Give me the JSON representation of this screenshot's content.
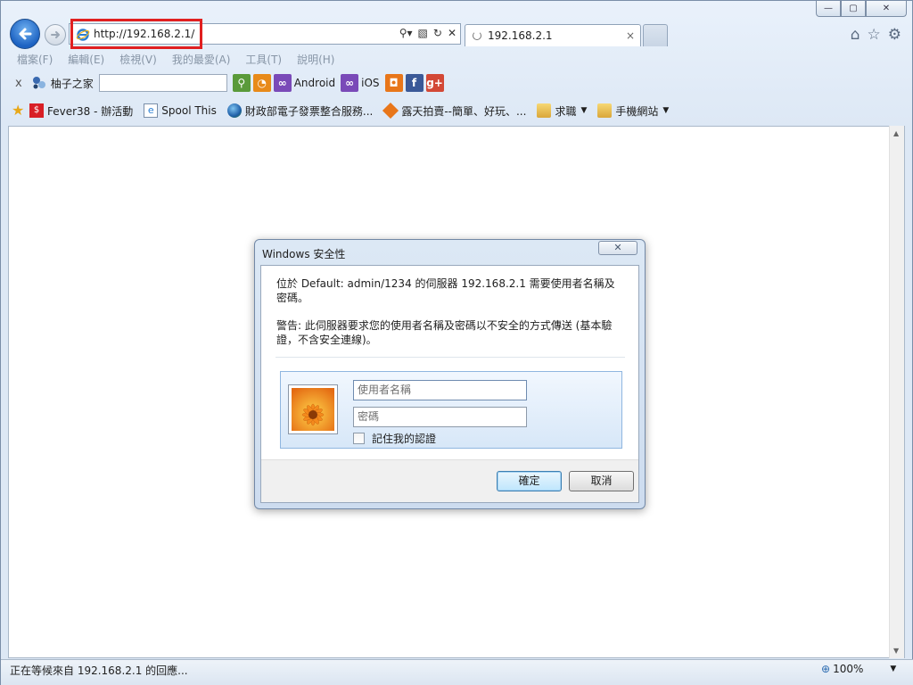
{
  "browser": {
    "address_url": "http://192.168.2.1/",
    "tab_title": "192.168.2.1",
    "tab_close": "×",
    "caption": {
      "minimize": "—",
      "maximize": "▢",
      "close": "✕"
    },
    "right_icons": {
      "home": "⌂",
      "favorites": "☆",
      "tools": "⚙"
    }
  },
  "menu": [
    {
      "label": "檔案(F)"
    },
    {
      "label": "編輯(E)"
    },
    {
      "label": "檢視(V)"
    },
    {
      "label": "我的最愛(A)"
    },
    {
      "label": "工具(T)"
    },
    {
      "label": "說明(H)"
    }
  ],
  "toolbar": {
    "close_label": "x",
    "site_label": "柚子之家",
    "android_label": "Android",
    "ios_label": "iOS"
  },
  "favorites": [
    {
      "label": "Fever38 - 辦活動"
    },
    {
      "label": "Spool This"
    },
    {
      "label": "財政部電子發票整合服務..."
    },
    {
      "label": "露天拍賣--簡單、好玩、..."
    },
    {
      "label": "求職",
      "dropdown": true
    },
    {
      "label": "手機網站",
      "dropdown": true
    }
  ],
  "status": {
    "text": "正在等候來自 192.168.2.1 的回應...",
    "zoom": "100%"
  },
  "dialog": {
    "title": "Windows 安全性",
    "close": "✕",
    "message": "位於 Default: admin/1234 的伺服器 192.168.2.1 需要使用者名稱及密碼。",
    "warning": "警告: 此伺服器要求您的使用者名稱及密碼以不安全的方式傳送 (基本驗證，不含安全連線)。",
    "username_placeholder": "使用者名稱",
    "password_placeholder": "密碼",
    "remember_label": "記住我的認證",
    "ok_label": "確定",
    "cancel_label": "取消"
  }
}
